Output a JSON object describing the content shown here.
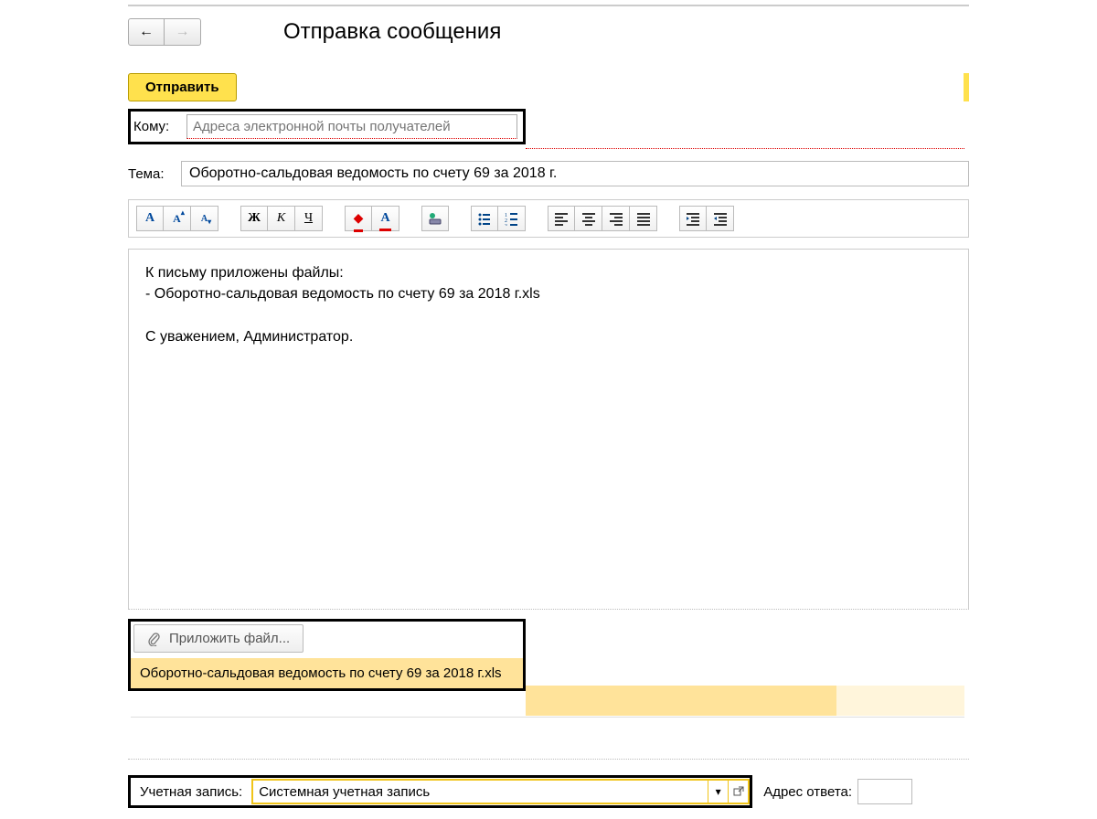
{
  "header": {
    "title": "Отправка сообщения"
  },
  "actions": {
    "send_label": "Отправить"
  },
  "fields": {
    "to_label": "Кому:",
    "to_placeholder": "Адреса электронной почты получателей",
    "subject_label": "Тема:",
    "subject_value": "Оборотно-сальдовая ведомость по счету 69 за 2018 г."
  },
  "toolbar": {
    "font_A": "A",
    "font_bigger": "A",
    "font_smaller": "A",
    "bold": "Ж",
    "italic": "К",
    "underline": "Ч",
    "fg": "A",
    "bg": "A"
  },
  "body": {
    "text": "К письму приложены файлы:\n- Оборотно-сальдовая ведомость по счету 69 за 2018 г.xls\n\nС уважением, Администратор."
  },
  "attachments": {
    "attach_label": "Приложить файл...",
    "items": [
      "Оборотно-сальдовая ведомость по счету 69 за 2018 г.xls"
    ]
  },
  "footer": {
    "account_label": "Учетная запись:",
    "account_value": "Системная учетная запись",
    "reply_label": "Адрес ответа:"
  }
}
